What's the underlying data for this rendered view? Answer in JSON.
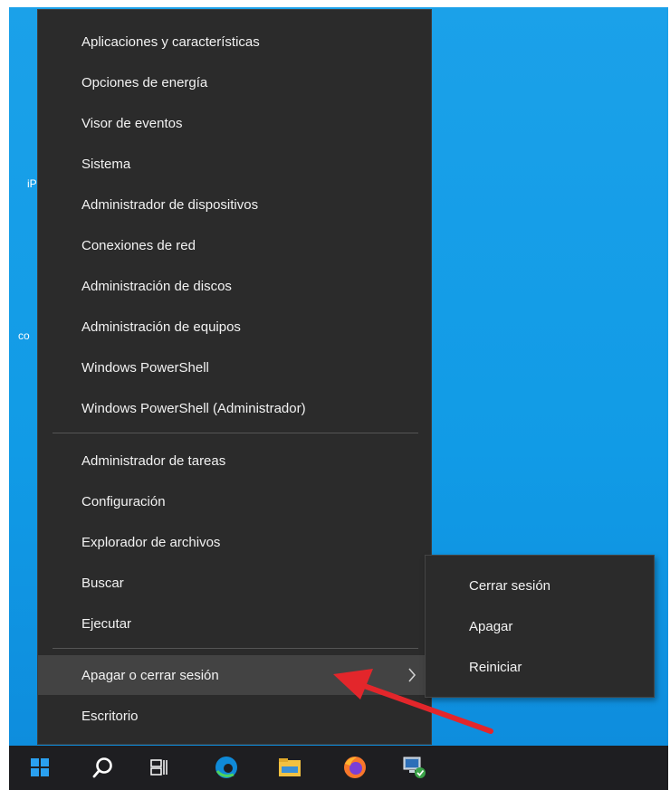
{
  "desktop": {
    "peek_labels": [
      "iP",
      "co"
    ]
  },
  "context_menu": {
    "group1": [
      "Aplicaciones y características",
      "Opciones de energía",
      "Visor de eventos",
      "Sistema",
      "Administrador de dispositivos",
      "Conexiones de red",
      "Administración de discos",
      "Administración de equipos",
      "Windows PowerShell",
      "Windows PowerShell (Administrador)"
    ],
    "group2": [
      "Administrador de tareas",
      "Configuración",
      "Explorador de archivos",
      "Buscar",
      "Ejecutar"
    ],
    "group3": [
      "Apagar o cerrar sesión",
      "Escritorio"
    ]
  },
  "submenu": {
    "items": [
      "Cerrar sesión",
      "Apagar",
      "Reiniciar"
    ]
  },
  "taskbar": {
    "icons": [
      "windows-start-icon",
      "search-icon",
      "task-view-icon",
      "edge-icon",
      "file-explorer-icon",
      "firefox-icon",
      "network-computer-icon"
    ]
  },
  "colors": {
    "desktop_bg": "#1ba1e9",
    "menu_bg": "#2b2b2b",
    "menu_highlight": "#434343",
    "taskbar_bg": "#1e1e21",
    "annotation_arrow": "#e3262b"
  }
}
